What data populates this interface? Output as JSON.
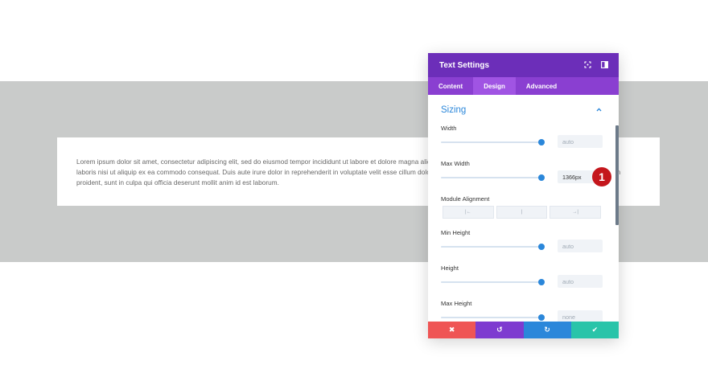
{
  "content": {
    "lorem": "Lorem ipsum dolor sit amet, consectetur adipiscing elit, sed do eiusmod tempor incididunt ut labore et dolore magna aliqua. Ut enim ad minim veniam, quis nostrud exercitation ullamco laboris nisi ut aliquip ex ea commodo consequat. Duis aute irure dolor in reprehenderit in voluptate velit esse cillum dolore eu fugiat nulla pariatur. Excepteur sint occaecat cupidatat non proident, sunt in culpa qui officia deserunt mollit anim id est laborum."
  },
  "modal": {
    "title": "Text Settings",
    "tabs": [
      {
        "label": "Content",
        "active": false
      },
      {
        "label": "Design",
        "active": true
      },
      {
        "label": "Advanced",
        "active": false
      }
    ],
    "section_title": "Sizing",
    "fields": {
      "width": {
        "label": "Width",
        "value": "auto",
        "slider_fraction": 1.0
      },
      "max_width": {
        "label": "Max Width",
        "value": "1366px",
        "slider_fraction": 1.0
      },
      "module_alignment": {
        "label": "Module Alignment",
        "options": [
          "|←",
          "|",
          "→|"
        ]
      },
      "min_height": {
        "label": "Min Height",
        "value": "auto",
        "slider_fraction": 1.0
      },
      "height": {
        "label": "Height",
        "value": "auto",
        "slider_fraction": 1.0
      },
      "max_height": {
        "label": "Max Height",
        "value": "none",
        "slider_fraction": 1.0
      }
    },
    "marker": "1",
    "footer": {
      "discard": "✖",
      "undo": "↺",
      "redo": "↻",
      "save": "✔"
    }
  },
  "colors": {
    "header": "#6c2eb9",
    "tabs": "#8a3fd1",
    "accent": "#2b87da",
    "discard": "#ef5555",
    "save": "#29c4a9",
    "marker": "#c4161c"
  }
}
